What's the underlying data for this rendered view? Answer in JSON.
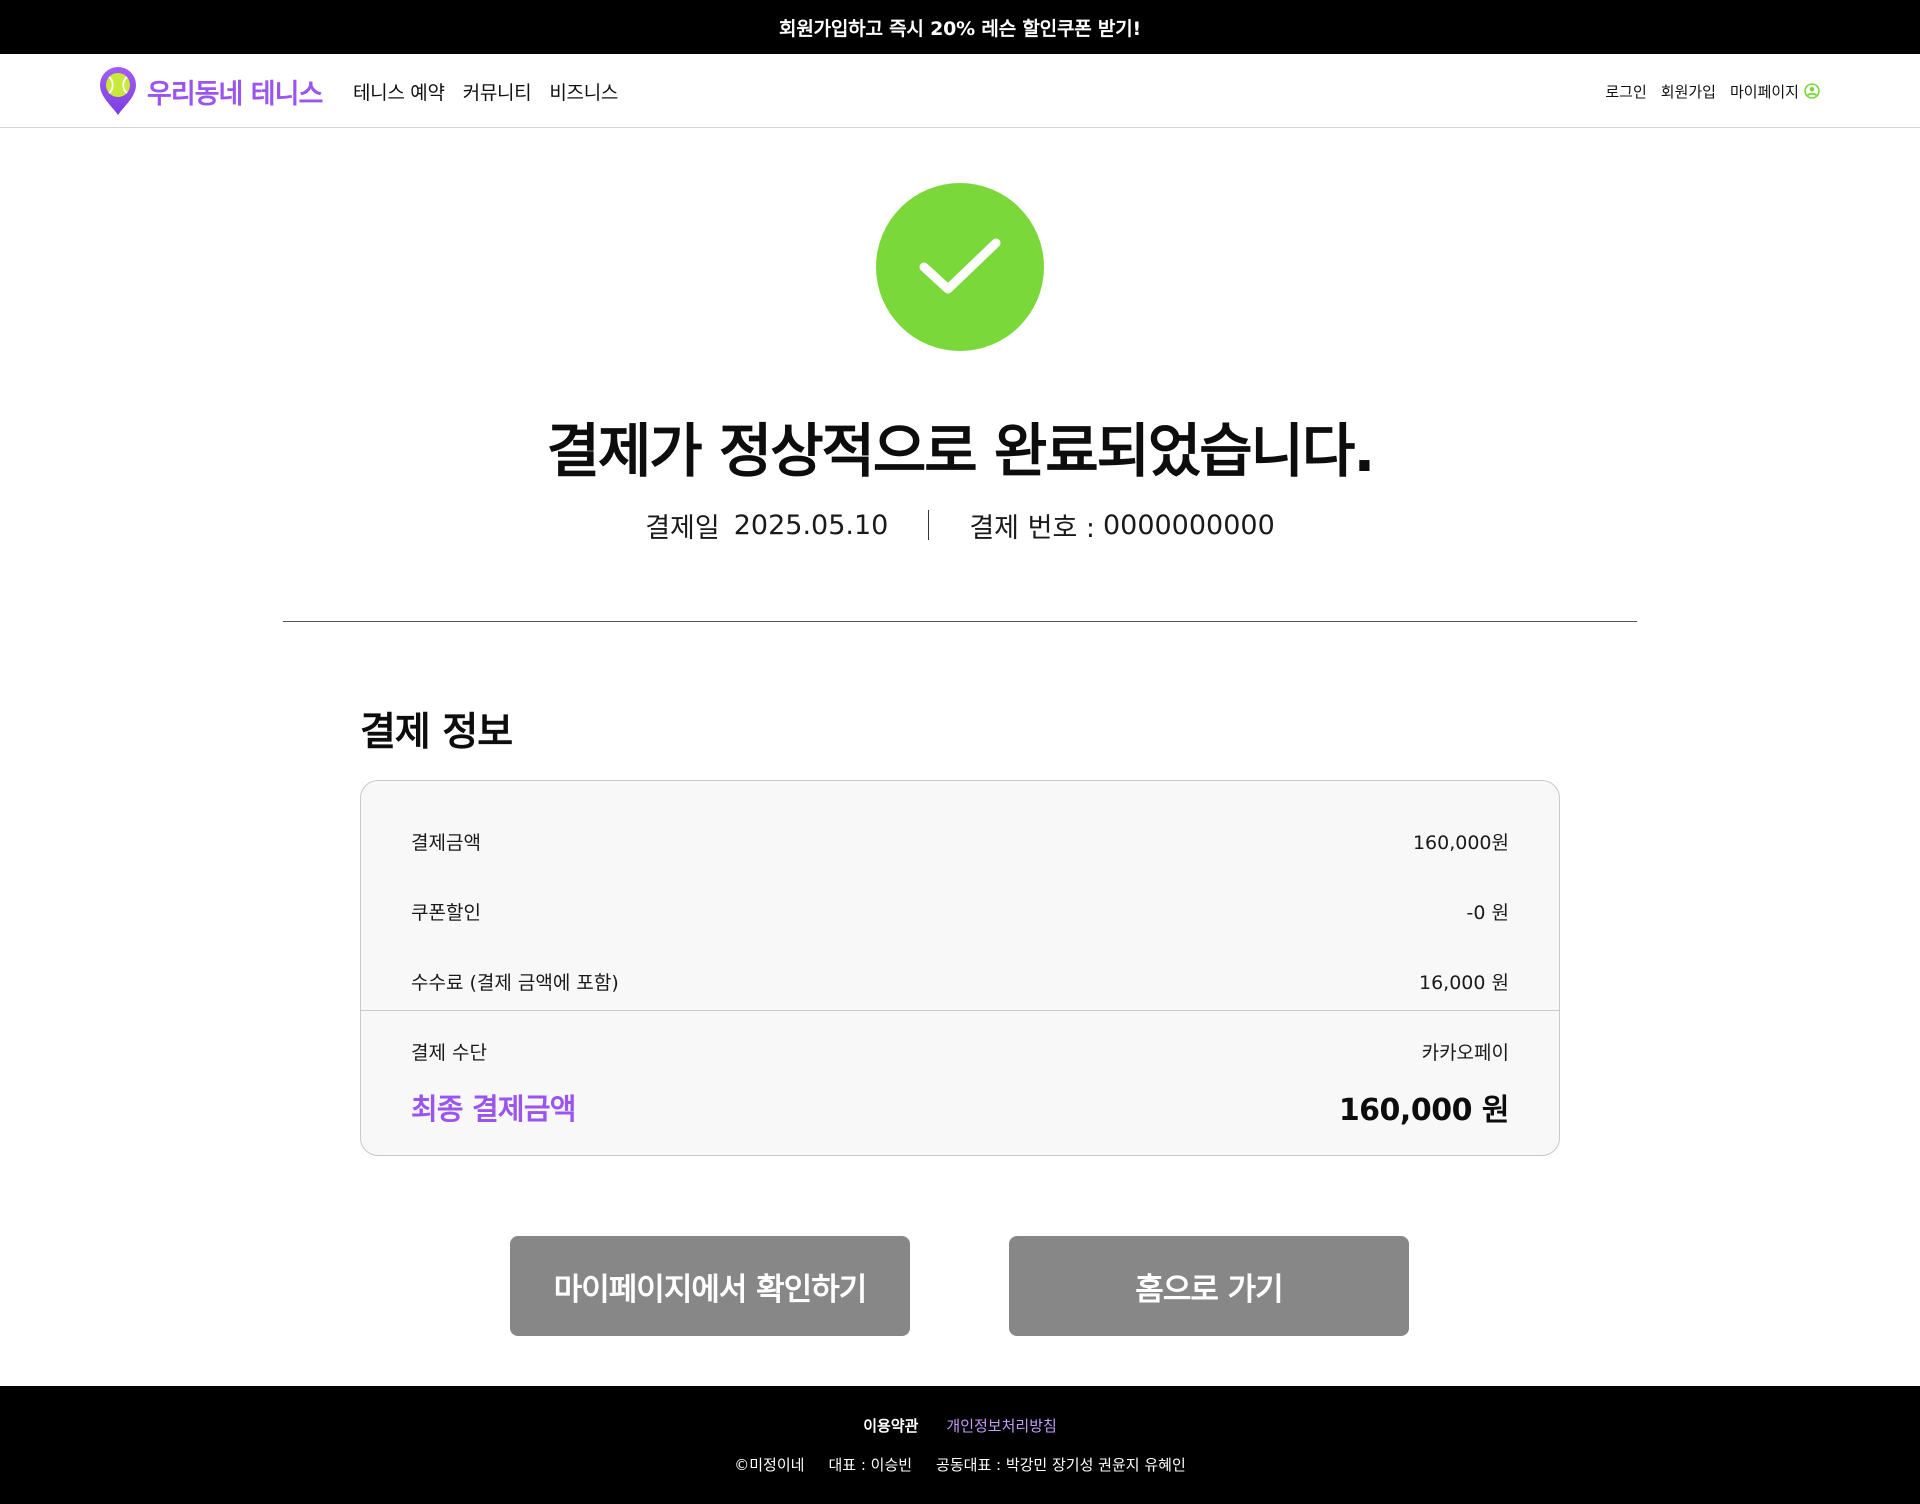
{
  "promo_banner": {
    "text": "회원가입하고 즉시 20% 레슨 할인쿠폰 받기!"
  },
  "header": {
    "logo_text": "우리동네 테니스",
    "nav": [
      {
        "label": "테니스 예약"
      },
      {
        "label": "커뮤니티"
      },
      {
        "label": "비즈니스"
      }
    ],
    "util": {
      "login": "로그인",
      "signup": "회원가입",
      "mypage": "마이페이지"
    }
  },
  "result": {
    "headline": "결제가 정상적으로 완료되었습니다.",
    "payment_date_label": "결제일",
    "payment_date": "2025.05.10",
    "payment_number_label": "결제 번호 :",
    "payment_number": "0000000000"
  },
  "payment_info": {
    "title": "결제 정보",
    "rows": [
      {
        "label": "결제금액",
        "value": "160,000원"
      },
      {
        "label": "쿠폰할인",
        "value": "-0 원"
      },
      {
        "label": "수수료 (결제 금액에 포함)",
        "value": "16,000 원"
      },
      {
        "label": "결제 수단",
        "value": "카카오페이"
      }
    ],
    "total_label": "최종 결제금액",
    "total_value": "160,000 원"
  },
  "buttons": {
    "mypage": "마이페이지에서 확인하기",
    "home": "홈으로 가기"
  },
  "footer": {
    "terms": "이용약관",
    "privacy": "개인정보처리방침",
    "copyright": "©미정이네",
    "ceo": "대표 : 이승빈",
    "co_ceo": "공동대표 : 박강민 장기성 권윤지 유혜인"
  },
  "colors": {
    "brand_purple": "#9a55ee",
    "success_green": "#7bd83b",
    "button_gray": "#878787",
    "privacy_link": "#c39cf6"
  },
  "icons": {
    "logo": "tennis-ball-pin-icon",
    "user": "user-circle-icon",
    "success": "checkmark-icon"
  }
}
